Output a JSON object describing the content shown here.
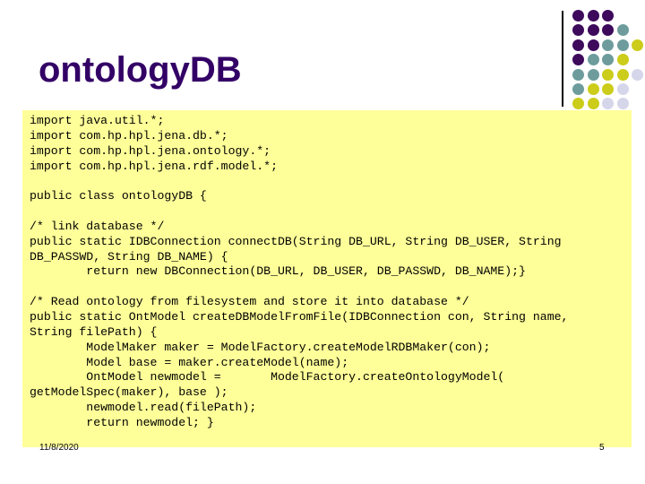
{
  "slide": {
    "title": "ontologyDB",
    "footer": {
      "date": "11/8/2020",
      "page": "5"
    },
    "colors": {
      "title": "#330066",
      "code_background": "#ffff99",
      "dot_purple": "#3d0a5c",
      "dot_teal": "#6e9c9c",
      "dot_yellow": "#cccc1a",
      "dot_lavender": "#d6d6ea"
    },
    "code_lines": [
      "import java.util.*;",
      "import com.hp.hpl.jena.db.*;",
      "import com.hp.hpl.jena.ontology.*;",
      "import com.hp.hpl.jena.rdf.model.*;",
      "",
      "public class ontologyDB {",
      "",
      "/* link database */",
      "public static IDBConnection connectDB(String DB_URL, String DB_USER, String",
      "DB_PASSWD, String DB_NAME) {",
      "        return new DBConnection(DB_URL, DB_USER, DB_PASSWD, DB_NAME);}",
      "",
      "/* Read ontology from filesystem and store it into database */",
      "public static OntModel createDBModelFromFile(IDBConnection con, String name,",
      "String filePath) {",
      "        ModelMaker maker = ModelFactory.createModelRDBMaker(con);",
      "        Model base = maker.createModel(name);",
      "        OntModel newmodel =       ModelFactory.createOntologyModel(",
      "getModelSpec(maker), base );",
      "        newmodel.read(filePath);",
      "        return newmodel; }"
    ]
  }
}
